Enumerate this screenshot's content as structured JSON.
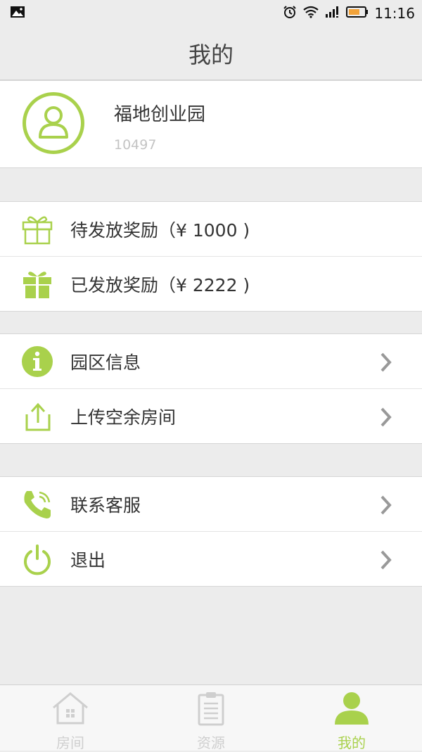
{
  "status_bar": {
    "time": "11:16",
    "icons": [
      "image-icon",
      "alarm-icon",
      "wifi-icon",
      "signal-icon",
      "battery-icon"
    ]
  },
  "header": {
    "title": "我的"
  },
  "profile": {
    "name": "福地创业园",
    "id": "10497"
  },
  "rewards": [
    {
      "label": "待发放奖励（¥ 1000 )",
      "icon": "gift-outline-icon"
    },
    {
      "label": "已发放奖励（¥ 2222 )",
      "icon": "gift-filled-icon"
    }
  ],
  "park_menu": [
    {
      "label": "园区信息",
      "icon": "info-icon"
    },
    {
      "label": "上传空余房间",
      "icon": "upload-icon"
    }
  ],
  "support_menu": [
    {
      "label": "联系客服",
      "icon": "phone-icon"
    },
    {
      "label": "退出",
      "icon": "power-icon"
    }
  ],
  "tabs": [
    {
      "label": "房间",
      "icon": "house-icon",
      "active": false
    },
    {
      "label": "资源",
      "icon": "clipboard-icon",
      "active": false
    },
    {
      "label": "我的",
      "icon": "person-icon",
      "active": true
    }
  ],
  "colors": {
    "accent": "#a9d14c",
    "inactive": "#cfcfcf",
    "background": "#ececec"
  }
}
